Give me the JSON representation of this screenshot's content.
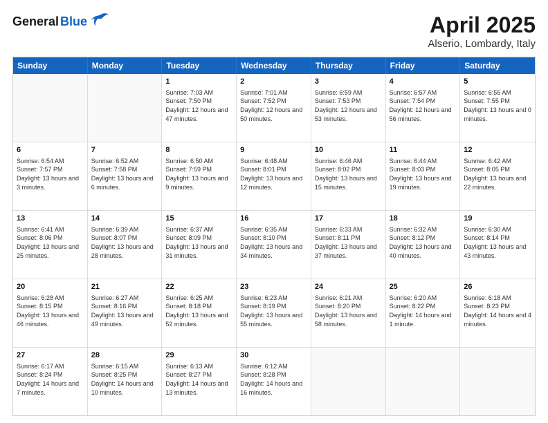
{
  "header": {
    "logo_general": "General",
    "logo_blue": "Blue",
    "month": "April 2025",
    "location": "Alserio, Lombardy, Italy"
  },
  "days_of_week": [
    "Sunday",
    "Monday",
    "Tuesday",
    "Wednesday",
    "Thursday",
    "Friday",
    "Saturday"
  ],
  "weeks": [
    [
      {
        "day": "",
        "info": ""
      },
      {
        "day": "",
        "info": ""
      },
      {
        "day": "1",
        "info": "Sunrise: 7:03 AM\nSunset: 7:50 PM\nDaylight: 12 hours and 47 minutes."
      },
      {
        "day": "2",
        "info": "Sunrise: 7:01 AM\nSunset: 7:52 PM\nDaylight: 12 hours and 50 minutes."
      },
      {
        "day": "3",
        "info": "Sunrise: 6:59 AM\nSunset: 7:53 PM\nDaylight: 12 hours and 53 minutes."
      },
      {
        "day": "4",
        "info": "Sunrise: 6:57 AM\nSunset: 7:54 PM\nDaylight: 12 hours and 56 minutes."
      },
      {
        "day": "5",
        "info": "Sunrise: 6:55 AM\nSunset: 7:55 PM\nDaylight: 13 hours and 0 minutes."
      }
    ],
    [
      {
        "day": "6",
        "info": "Sunrise: 6:54 AM\nSunset: 7:57 PM\nDaylight: 13 hours and 3 minutes."
      },
      {
        "day": "7",
        "info": "Sunrise: 6:52 AM\nSunset: 7:58 PM\nDaylight: 13 hours and 6 minutes."
      },
      {
        "day": "8",
        "info": "Sunrise: 6:50 AM\nSunset: 7:59 PM\nDaylight: 13 hours and 9 minutes."
      },
      {
        "day": "9",
        "info": "Sunrise: 6:48 AM\nSunset: 8:01 PM\nDaylight: 13 hours and 12 minutes."
      },
      {
        "day": "10",
        "info": "Sunrise: 6:46 AM\nSunset: 8:02 PM\nDaylight: 13 hours and 15 minutes."
      },
      {
        "day": "11",
        "info": "Sunrise: 6:44 AM\nSunset: 8:03 PM\nDaylight: 13 hours and 19 minutes."
      },
      {
        "day": "12",
        "info": "Sunrise: 6:42 AM\nSunset: 8:05 PM\nDaylight: 13 hours and 22 minutes."
      }
    ],
    [
      {
        "day": "13",
        "info": "Sunrise: 6:41 AM\nSunset: 8:06 PM\nDaylight: 13 hours and 25 minutes."
      },
      {
        "day": "14",
        "info": "Sunrise: 6:39 AM\nSunset: 8:07 PM\nDaylight: 13 hours and 28 minutes."
      },
      {
        "day": "15",
        "info": "Sunrise: 6:37 AM\nSunset: 8:09 PM\nDaylight: 13 hours and 31 minutes."
      },
      {
        "day": "16",
        "info": "Sunrise: 6:35 AM\nSunset: 8:10 PM\nDaylight: 13 hours and 34 minutes."
      },
      {
        "day": "17",
        "info": "Sunrise: 6:33 AM\nSunset: 8:11 PM\nDaylight: 13 hours and 37 minutes."
      },
      {
        "day": "18",
        "info": "Sunrise: 6:32 AM\nSunset: 8:12 PM\nDaylight: 13 hours and 40 minutes."
      },
      {
        "day": "19",
        "info": "Sunrise: 6:30 AM\nSunset: 8:14 PM\nDaylight: 13 hours and 43 minutes."
      }
    ],
    [
      {
        "day": "20",
        "info": "Sunrise: 6:28 AM\nSunset: 8:15 PM\nDaylight: 13 hours and 46 minutes."
      },
      {
        "day": "21",
        "info": "Sunrise: 6:27 AM\nSunset: 8:16 PM\nDaylight: 13 hours and 49 minutes."
      },
      {
        "day": "22",
        "info": "Sunrise: 6:25 AM\nSunset: 8:18 PM\nDaylight: 13 hours and 52 minutes."
      },
      {
        "day": "23",
        "info": "Sunrise: 6:23 AM\nSunset: 8:19 PM\nDaylight: 13 hours and 55 minutes."
      },
      {
        "day": "24",
        "info": "Sunrise: 6:21 AM\nSunset: 8:20 PM\nDaylight: 13 hours and 58 minutes."
      },
      {
        "day": "25",
        "info": "Sunrise: 6:20 AM\nSunset: 8:22 PM\nDaylight: 14 hours and 1 minute."
      },
      {
        "day": "26",
        "info": "Sunrise: 6:18 AM\nSunset: 8:23 PM\nDaylight: 14 hours and 4 minutes."
      }
    ],
    [
      {
        "day": "27",
        "info": "Sunrise: 6:17 AM\nSunset: 8:24 PM\nDaylight: 14 hours and 7 minutes."
      },
      {
        "day": "28",
        "info": "Sunrise: 6:15 AM\nSunset: 8:25 PM\nDaylight: 14 hours and 10 minutes."
      },
      {
        "day": "29",
        "info": "Sunrise: 6:13 AM\nSunset: 8:27 PM\nDaylight: 14 hours and 13 minutes."
      },
      {
        "day": "30",
        "info": "Sunrise: 6:12 AM\nSunset: 8:28 PM\nDaylight: 14 hours and 16 minutes."
      },
      {
        "day": "",
        "info": ""
      },
      {
        "day": "",
        "info": ""
      },
      {
        "day": "",
        "info": ""
      }
    ]
  ]
}
